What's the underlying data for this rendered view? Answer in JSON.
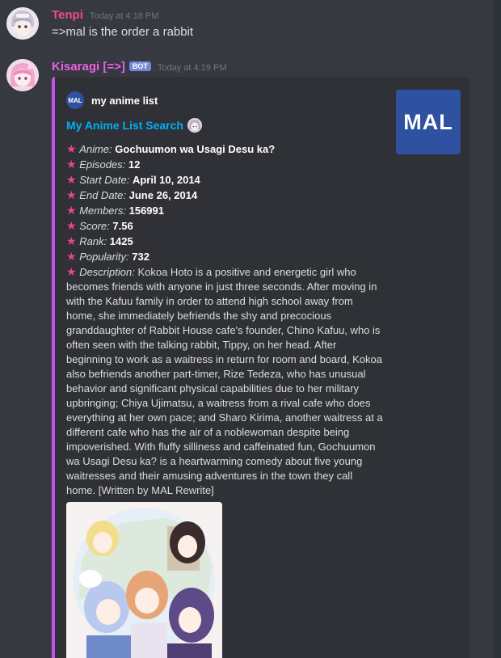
{
  "messages": [
    {
      "username": "Tenpi",
      "username_color": "#f04c8a",
      "timestamp": "Today at 4:18 PM",
      "text": "=>mal is the order a rabbit"
    },
    {
      "username": "Kisaragi [=>]",
      "username_color": "#e860e6",
      "bot_tag": "BOT",
      "timestamp": "Today at 4:19 PM"
    }
  ],
  "embed": {
    "accent_color": "#c554ec",
    "author_icon_text": "MAL",
    "author_name": "my anime list",
    "title": "My Anime List Search",
    "thumbnail_text": "MAL",
    "fields": [
      {
        "label": "Anime:",
        "value": "Gochuumon wa Usagi Desu ka?"
      },
      {
        "label": "Episodes:",
        "value": "12"
      },
      {
        "label": "Start Date:",
        "value": "April 10, 2014"
      },
      {
        "label": "End Date:",
        "value": "June 26, 2014"
      },
      {
        "label": "Members:",
        "value": "156991"
      },
      {
        "label": "Score:",
        "value": "7.56"
      },
      {
        "label": "Rank:",
        "value": "1425"
      },
      {
        "label": "Popularity:",
        "value": "732"
      }
    ],
    "description_label": "Description:",
    "description": "Kokoa Hoto is a positive and energetic girl who becomes friends with anyone in just three seconds. After moving in with the Kafuu family in order to attend high school away from home, she immediately befriends the shy and precocious granddaughter of Rabbit House cafe's founder, Chino Kafuu, who is often seen with the talking rabbit, Tippy, on her head. After beginning to work as a waitress in return for room and board, Kokoa also befriends another part-timer, Rize Tedeza, who has unusual behavior and significant physical capabilities due to her military upbringing; Chiya Ujimatsu, a waitress from a rival cafe who does everything at her own pace; and Sharo Kirima, another waitress at a different cafe who has the air of a noblewoman despite being impoverished. With fluffy silliness and caffeinated fun, Gochuumon wa Usagi Desu ka? is a heartwarming comedy about five young waitresses and their amusing adventures in the town they call home. [Written by MAL Rewrite]"
  },
  "icons": {
    "field_bullet": "star-icon",
    "star_color": "#f0428f"
  }
}
